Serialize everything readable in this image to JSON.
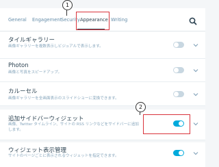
{
  "tabs": [
    {
      "label": "General"
    },
    {
      "label": "Engagement"
    },
    {
      "label": "Security"
    },
    {
      "label": "Appearance",
      "active": true
    },
    {
      "label": "Writing"
    }
  ],
  "callouts": {
    "one": "1",
    "two": "2"
  },
  "cards": [
    {
      "title": "タイルギャラリー",
      "description": "画像ギャラリーを複数表示しビジュアルで表示します。",
      "enabled": false
    },
    {
      "title": "Photon",
      "description": "画像と写真をスピードアップ。",
      "enabled": false
    },
    {
      "title": "カルーセル",
      "description": "画像ギャラリーを全画面表示のスライドショーに変換できます。",
      "enabled": false
    },
    {
      "title": "追加サイドバーウィジェット",
      "description": "画像、Twitter タイムライン、サイトの RSS リンクなどをサイドバーに追加します。",
      "enabled": true
    },
    {
      "title": "ウィジェット表示管理",
      "description": "サイトのページごとに表示されるウィジェットを指定できます。",
      "enabled": true
    }
  ],
  "colors": {
    "accent": "#00aadc",
    "highlight": "#d9323a"
  }
}
